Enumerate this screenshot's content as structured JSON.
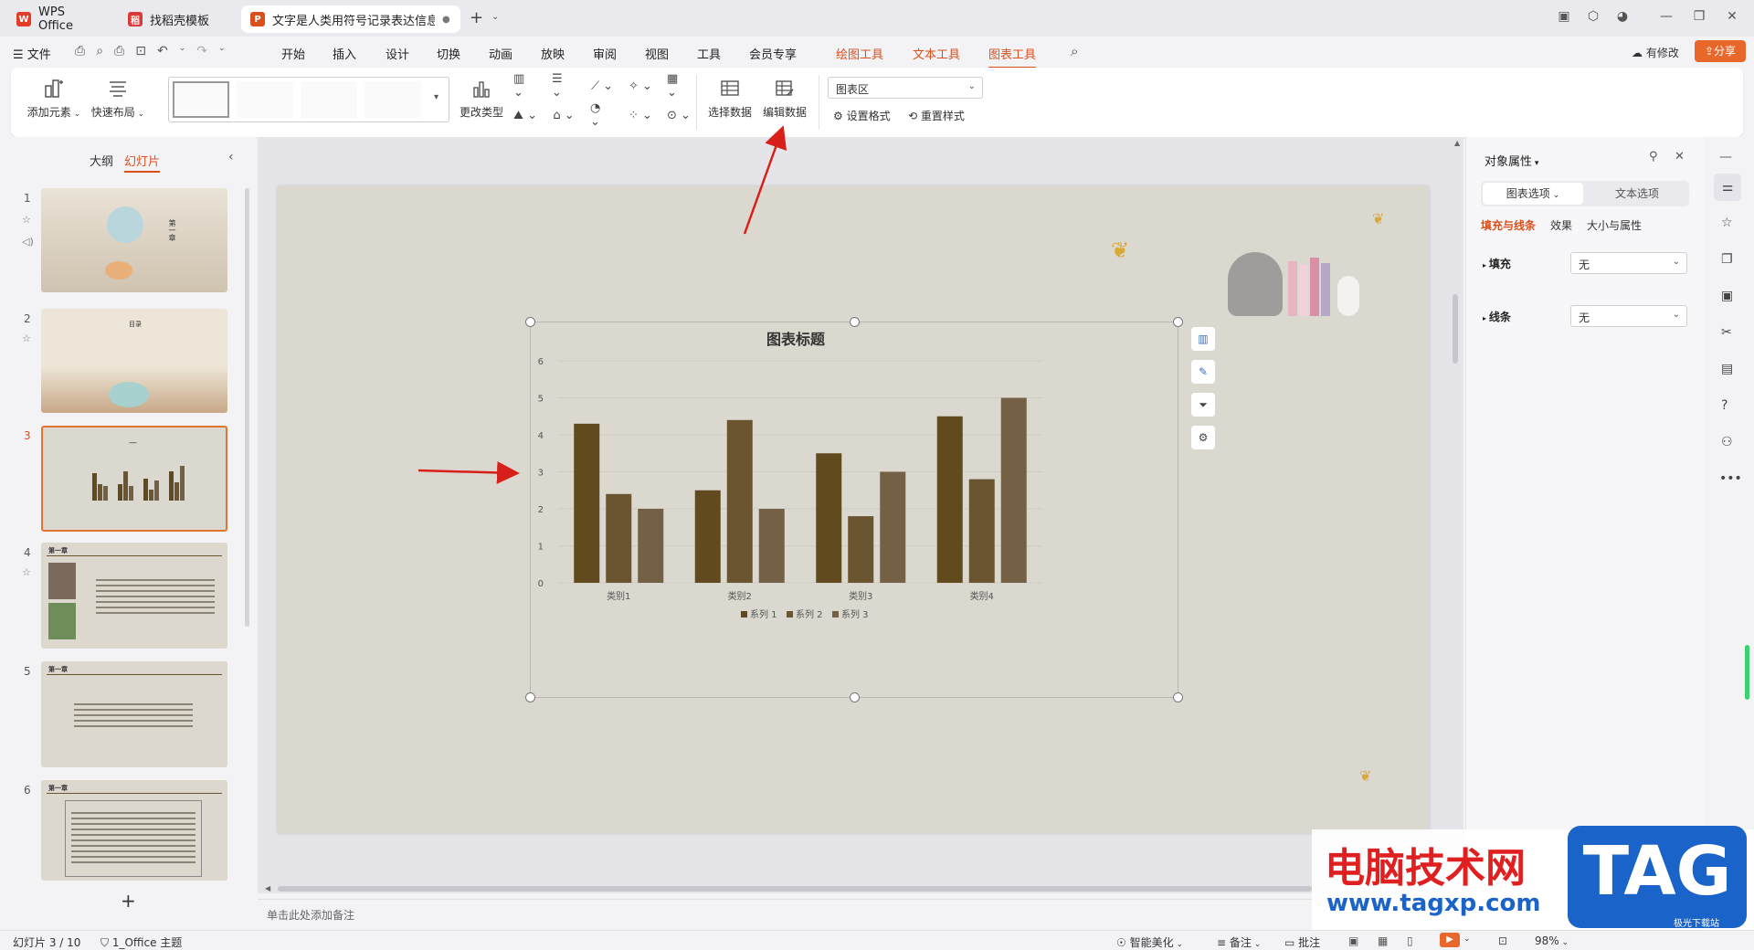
{
  "tabs": [
    {
      "label": "WPS Office",
      "icon": "wps-logo-icon",
      "color": "#e23d29"
    },
    {
      "label": "找稻壳模板",
      "icon": "docer-icon",
      "color": "#d93a3a"
    },
    {
      "label": "文字是人类用符号记录表达信息以…",
      "icon": "ppt-file-icon",
      "color": "#d9501c"
    }
  ],
  "menu": {
    "file": "文件",
    "items": [
      "开始",
      "插入",
      "设计",
      "切换",
      "动画",
      "放映",
      "审阅",
      "视图",
      "工具",
      "会员专享"
    ],
    "context_items": [
      "绘图工具",
      "文本工具",
      "图表工具"
    ],
    "active": "图表工具",
    "revision": "有修改",
    "share": "分享"
  },
  "ribbon": {
    "add_element": "添加元素",
    "quick_layout": "快速布局",
    "change_type": "更改类型",
    "select_data": "选择数据",
    "edit_data": "编辑数据",
    "chart_area_select": "图表区",
    "set_format": "设置格式",
    "reset_style": "重置样式"
  },
  "left_panel": {
    "tab_outline": "大纲",
    "tab_slides": "幻灯片",
    "active_tab": "幻灯片",
    "slides": [
      {
        "num": "1",
        "title": "第一章"
      },
      {
        "num": "2",
        "title": "目录"
      },
      {
        "num": "3",
        "title": "—"
      },
      {
        "num": "4",
        "title": "第一章"
      },
      {
        "num": "5",
        "title": "第一章"
      },
      {
        "num": "6",
        "title": "第一章"
      }
    ],
    "selected": "3",
    "add_label": "+"
  },
  "notes_placeholder": "单击此处添加备注",
  "chart_data": {
    "type": "bar",
    "title": "图表标题",
    "categories": [
      "类别1",
      "类别2",
      "类别3",
      "类别4"
    ],
    "series": [
      {
        "name": "系列 1",
        "values": [
          4.3,
          2.5,
          3.5,
          4.5
        ],
        "color": "#614a1e"
      },
      {
        "name": "系列 2",
        "values": [
          2.4,
          4.4,
          1.8,
          2.8
        ],
        "color": "#6b5531"
      },
      {
        "name": "系列 3",
        "values": [
          2.0,
          2.0,
          3.0,
          5.0
        ],
        "color": "#746145"
      }
    ],
    "ylim": [
      0,
      6
    ],
    "yticks": [
      "0",
      "1",
      "2",
      "3",
      "4",
      "5",
      "6"
    ],
    "grid": true,
    "legend_position": "bottom"
  },
  "right_panel": {
    "title": "对象属性",
    "tab_chart": "图表选项",
    "tab_text": "文本选项",
    "subtabs": [
      "填充与线条",
      "效果",
      "大小与属性"
    ],
    "fill_label": "填充",
    "fill_value": "无",
    "line_label": "线条",
    "line_value": "无"
  },
  "status": {
    "slide_info": "幻灯片 3 / 10",
    "theme": "1_Office 主题",
    "beautify": "智能美化",
    "notes": "备注",
    "comments": "批注",
    "zoom": "98%"
  },
  "watermark": {
    "site_cn": "电脑技术网",
    "url": "www.tagxp.com",
    "tag": "TAG",
    "sub": "极光下载站"
  },
  "colors": {
    "accent": "#d9501c",
    "bar1": "#614a1e",
    "bar2": "#6b5531",
    "bar3": "#746145",
    "slide_bg": "#dbd8cf"
  }
}
